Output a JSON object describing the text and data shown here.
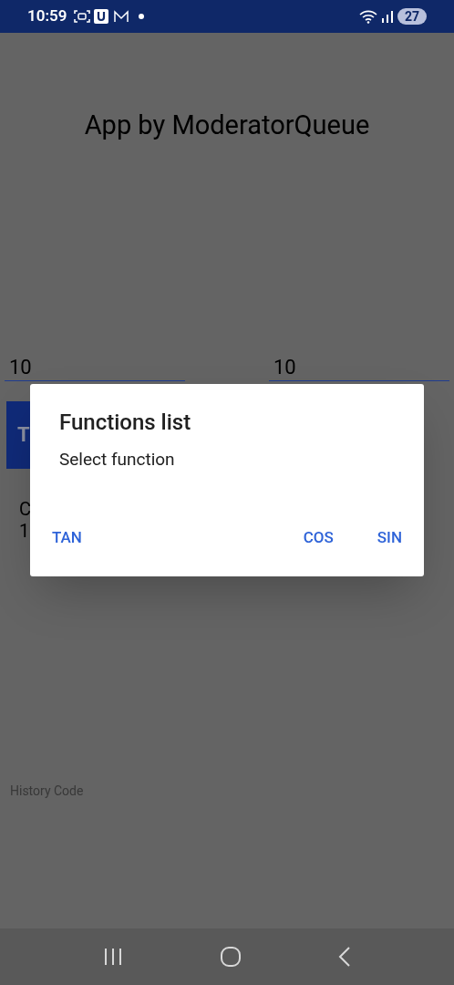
{
  "status_bar": {
    "time": "10:59",
    "battery": "27"
  },
  "title": "App by ModeratorQueue",
  "inputs": [
    {
      "value": "10"
    },
    {
      "value": "10"
    }
  ],
  "button_behind": {
    "label": "T"
  },
  "result_lines": [
    "C",
    "1"
  ],
  "history_label": "History Code",
  "dialog": {
    "title": "Functions list",
    "message": "Select function",
    "buttons": [
      {
        "label": "TAN"
      },
      {
        "label": "COS"
      },
      {
        "label": "SIN"
      }
    ]
  }
}
